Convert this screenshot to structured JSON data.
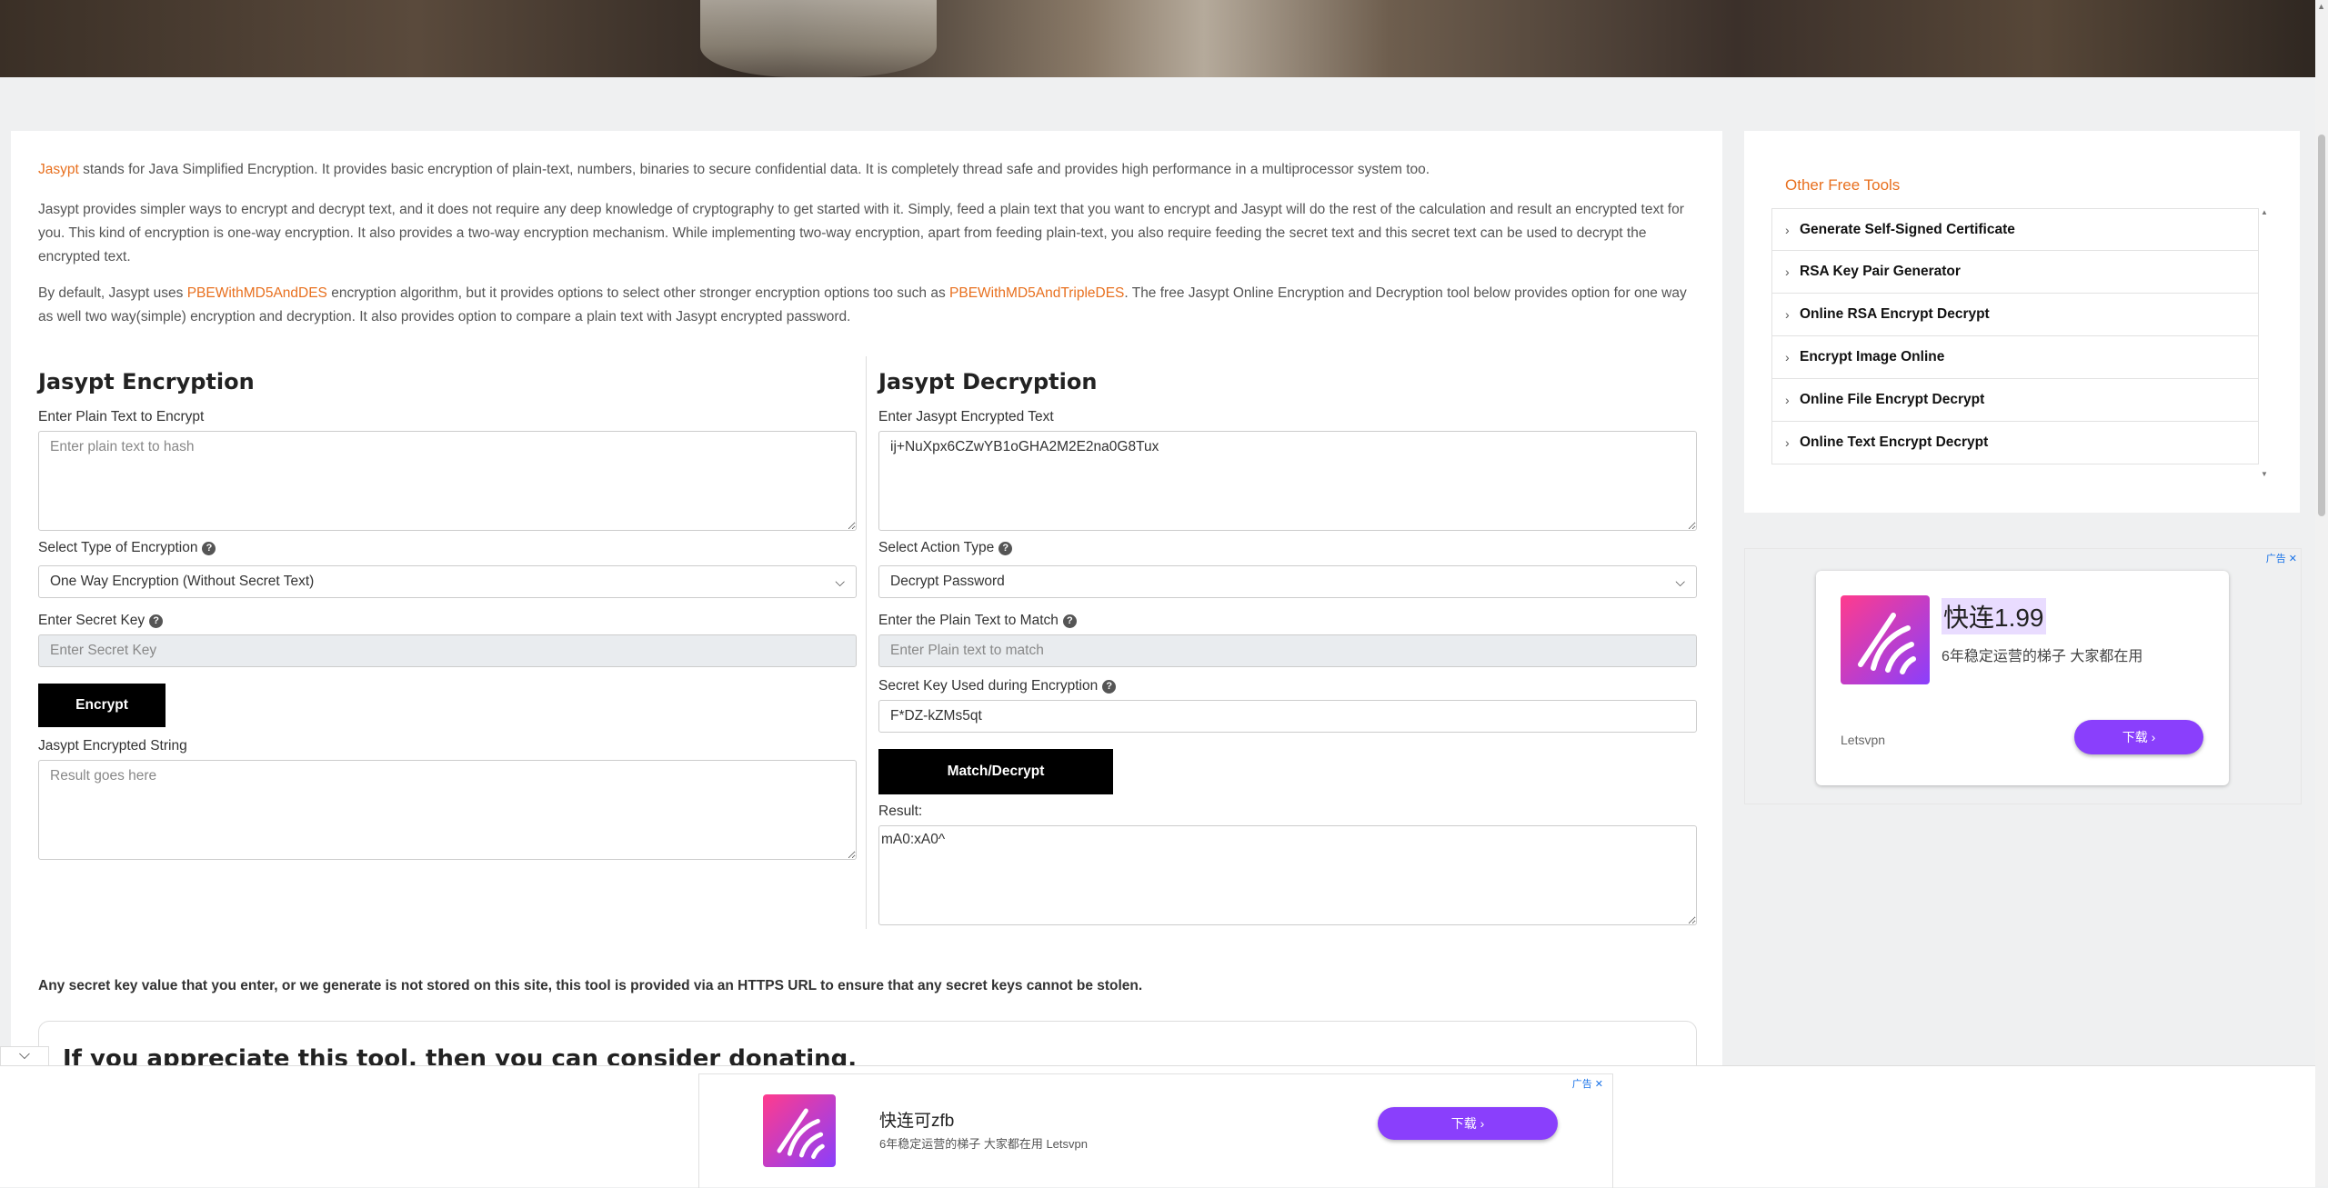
{
  "intro": {
    "p1_link": "Jasypt",
    "p1_text": " stands for Java Simplified Encryption. It provides basic encryption of plain-text, numbers, binaries to secure confidential data. It is completely thread safe and provides high performance in a multiprocessor system too.",
    "p2_text": "Jasypt provides simpler ways to encrypt and decrypt text, and it does not require any deep knowledge of cryptography to get started with it. Simply, feed a plain text that you want to encrypt and Jasypt will do the rest of the calculation and result an encrypted text for you. This kind of encryption is one-way encryption. It also provides a two-way encryption mechanism. While implementing two-way encryption, apart from feeding plain-text, you also require feeding the secret text and this secret text can be used to decrypt the encrypted text.",
    "p3_a": "By default, Jasypt uses ",
    "p3_link1": "PBEWithMD5AndDES",
    "p3_b": " encryption algorithm, but it provides options to select other stronger encryption options too such as ",
    "p3_link2": "PBEWithMD5AndTripleDES",
    "p3_c": ". The free Jasypt Online Encryption and Decryption tool below provides option for one way as well two way(simple) encryption and decryption. It also provides option to compare a plain text with Jasypt encrypted password."
  },
  "encryption": {
    "title": "Jasypt Encryption",
    "plain_label": "Enter Plain Text to Encrypt",
    "plain_placeholder": "Enter plain text to hash",
    "type_label": "Select Type of Encryption",
    "type_value": "One Way Encryption (Without Secret Text)",
    "secret_label": "Enter Secret Key",
    "secret_placeholder": "Enter Secret Key",
    "button": "Encrypt",
    "result_label": "Jasypt Encrypted String",
    "result_placeholder": "Result goes here"
  },
  "decryption": {
    "title": "Jasypt Decryption",
    "encrypted_label": "Enter Jasypt Encrypted Text",
    "encrypted_value": "ij+NuXpx6CZwYB1oGHA2M2E2na0G8Tux",
    "action_label": "Select Action Type",
    "action_value": "Decrypt Password",
    "match_label": "Enter the Plain Text to Match",
    "match_placeholder": "Enter Plain text to match",
    "secret_label": "Secret Key Used during Encryption",
    "secret_value": "F*DZ-kZMs5qt",
    "button": "Match/Decrypt",
    "result_label": "Result:",
    "result_value": "mA0:xA0^"
  },
  "help_glyph": "?",
  "note": "Any secret key value that you enter, or we generate is not stored on this site, this tool is provided via an HTTPS URL to ensure that any secret keys cannot be stolen.",
  "donate_title": "If you appreciate this tool, then you can consider donating.",
  "sidebar": {
    "title": "Other Free Tools",
    "items": [
      {
        "label": "Generate Self-Signed Certificate"
      },
      {
        "label": "RSA Key Pair Generator"
      },
      {
        "label": "Online RSA Encrypt Decrypt"
      },
      {
        "label": "Encrypt Image Online"
      },
      {
        "label": "Online File Encrypt Decrypt"
      },
      {
        "label": "Online Text Encrypt Decrypt"
      }
    ]
  },
  "side_ad": {
    "title": "快连1.99",
    "subtitle": "6年稳定运营的梯子 大家都在用",
    "brand": "Letsvpn",
    "button": "下载",
    "adchoices": "广告"
  },
  "bottom_ad": {
    "title": "快连可zfb",
    "subtitle": "6年稳定运营的梯子 大家都在用 Letsvpn",
    "button": "下载",
    "adchoices": "广告"
  },
  "colors": {
    "accent": "#e8701f",
    "button": "#000000",
    "ad_button": "#8a3ffc"
  }
}
